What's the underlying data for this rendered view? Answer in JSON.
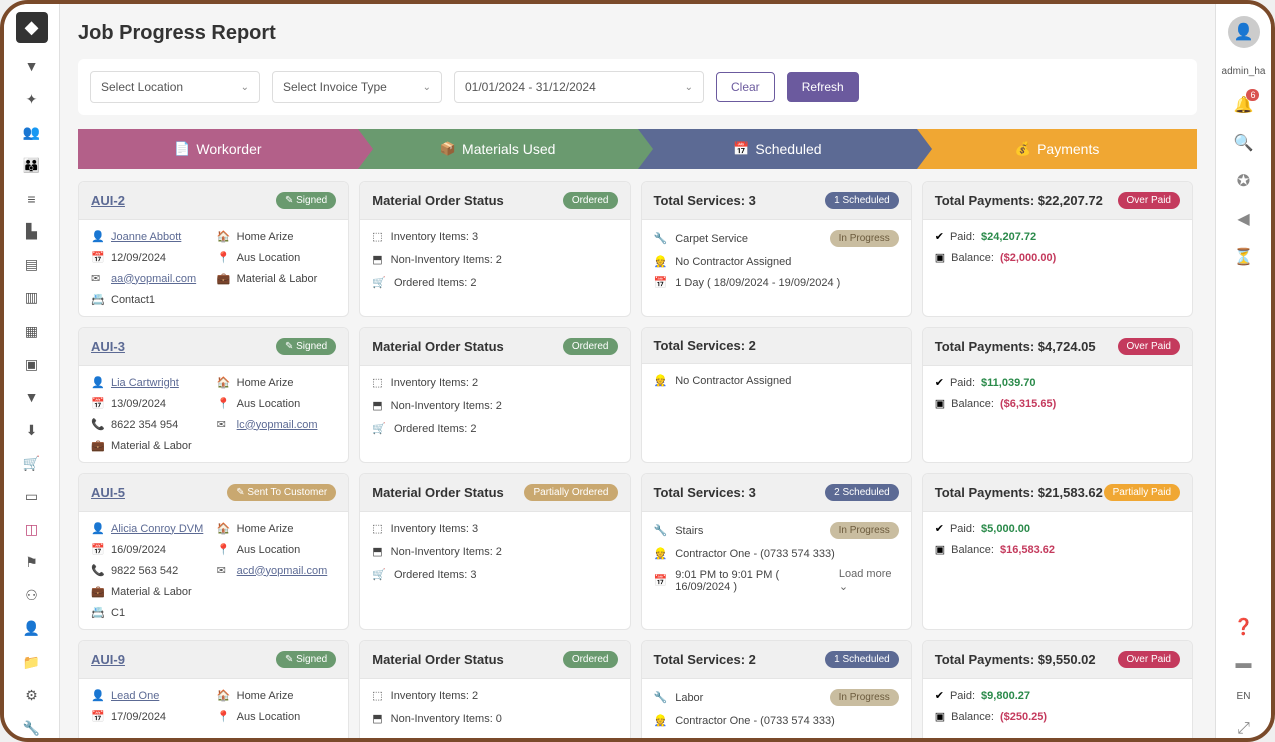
{
  "page": {
    "title": "Job Progress Report"
  },
  "user": {
    "name": "admin_ha"
  },
  "notifications": {
    "count": "6"
  },
  "filters": {
    "location": "Select Location",
    "invoiceType": "Select Invoice Type",
    "dateRange": "01/01/2024 - 31/12/2024",
    "clear": "Clear",
    "refresh": "Refresh"
  },
  "tabs": {
    "t1": "Workorder",
    "t2": "Materials Used",
    "t3": "Scheduled",
    "t4": "Payments"
  },
  "labels": {
    "mos": "Material Order Status",
    "inv": "Inventory Items:",
    "ninv": "Non-Inventory Items:",
    "ord": "Ordered Items:",
    "paid": "Paid:",
    "bal": "Balance:",
    "loadmore": "Load more"
  },
  "langCode": "EN",
  "rows": [
    {
      "wo": {
        "id": "AUI-2",
        "status": "Signed",
        "statusCls": "signed",
        "customer": "Joanne Abbott",
        "home": "Home Arize",
        "date": "12/09/2024",
        "location": "Aus Location",
        "email": "aa@yopmail.com",
        "type": "Material & Labor",
        "contact": "Contact1",
        "phone": ""
      },
      "mat": {
        "status": "Ordered",
        "statusCls": "ordered",
        "inv": "3",
        "ninv": "2",
        "ord": "2"
      },
      "sched": {
        "title": "Total Services: 3",
        "badge": "1 Scheduled",
        "badgeCls": "scheduled",
        "items": [
          {
            "ic": "svc",
            "txt": "Carpet Service",
            "badge": "In Progress"
          },
          {
            "ic": "con",
            "txt": "No Contractor Assigned"
          },
          {
            "ic": "cal",
            "txt": "1 Day ( 18/09/2024 - 19/09/2024 )"
          }
        ]
      },
      "pay": {
        "title": "Total Payments: $22,207.72",
        "badge": "Over Paid",
        "badgeCls": "overpaid",
        "paid": "$24,207.72",
        "bal": "($2,000.00)"
      }
    },
    {
      "wo": {
        "id": "AUI-3",
        "status": "Signed",
        "statusCls": "signed",
        "customer": "Lia Cartwright",
        "home": "Home Arize",
        "date": "13/09/2024",
        "location": "Aus Location",
        "phone": "8622 354 954",
        "email": "lc@yopmail.com",
        "type": "Material & Labor",
        "contact": ""
      },
      "mat": {
        "status": "Ordered",
        "statusCls": "ordered",
        "inv": "2",
        "ninv": "2",
        "ord": "2"
      },
      "sched": {
        "title": "Total Services: 2",
        "badge": "",
        "items": [
          {
            "ic": "con",
            "txt": "No Contractor Assigned"
          }
        ]
      },
      "pay": {
        "title": "Total Payments: $4,724.05",
        "badge": "Over Paid",
        "badgeCls": "overpaid",
        "paid": "$11,039.70",
        "bal": "($6,315.65)"
      }
    },
    {
      "wo": {
        "id": "AUI-5",
        "status": "Sent To Customer",
        "statusCls": "sent",
        "customer": "Alicia Conroy DVM",
        "home": "Home Arize",
        "date": "16/09/2024",
        "location": "Aus Location",
        "phone": "9822 563 542",
        "email": "acd@yopmail.com",
        "type": "Material & Labor",
        "contact": "C1"
      },
      "mat": {
        "status": "Partially Ordered",
        "statusCls": "partial",
        "inv": "3",
        "ninv": "2",
        "ord": "3"
      },
      "sched": {
        "title": "Total Services: 3",
        "badge": "2 Scheduled",
        "badgeCls": "scheduled",
        "items": [
          {
            "ic": "svc",
            "txt": "Stairs",
            "badge": "In Progress"
          },
          {
            "ic": "con",
            "txt": "Contractor One - (0733 574 333)"
          },
          {
            "ic": "cal",
            "txt": "9:01 PM to 9:01 PM ( 16/09/2024 )",
            "loadmore": true
          }
        ]
      },
      "pay": {
        "title": "Total Payments: $21,583.62",
        "badge": "Partially Paid",
        "badgeCls": "partiallypaid",
        "paid": "$5,000.00",
        "bal": "$16,583.62"
      }
    },
    {
      "wo": {
        "id": "AUI-9",
        "status": "Signed",
        "statusCls": "signed",
        "customer": "Lead One",
        "home": "Home Arize",
        "date": "17/09/2024",
        "location": "Aus Location",
        "phone": "",
        "email": "",
        "type": "",
        "contact": ""
      },
      "mat": {
        "status": "Ordered",
        "statusCls": "ordered",
        "inv": "2",
        "ninv": "0",
        "ord": ""
      },
      "sched": {
        "title": "Total Services: 2",
        "badge": "1 Scheduled",
        "badgeCls": "scheduled",
        "items": [
          {
            "ic": "svc",
            "txt": "Labor",
            "badge": "In Progress"
          },
          {
            "ic": "con",
            "txt": "Contractor One - (0733 574 333)"
          }
        ]
      },
      "pay": {
        "title": "Total Payments: $9,550.02",
        "badge": "Over Paid",
        "badgeCls": "overpaid",
        "paid": "$9,800.27",
        "bal": "($250.25)"
      }
    }
  ]
}
